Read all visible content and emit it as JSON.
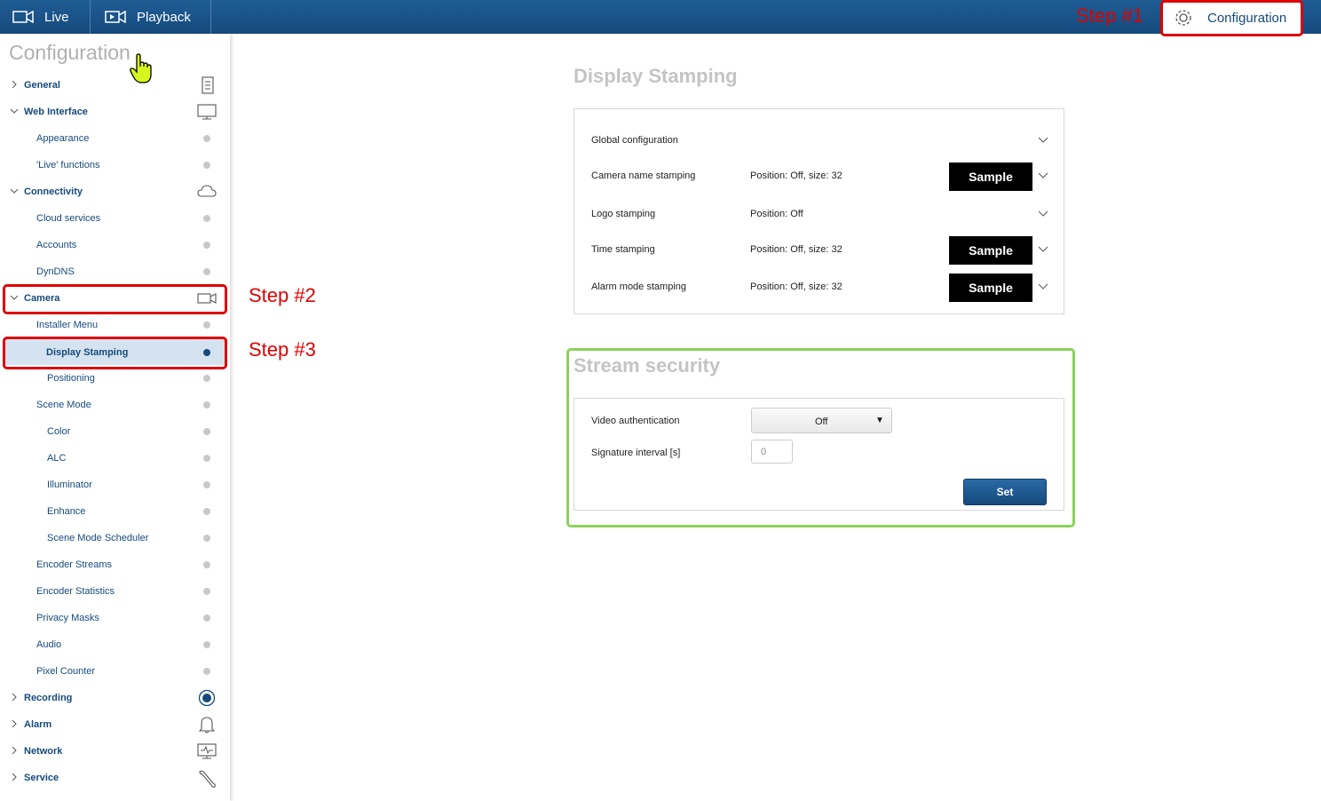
{
  "topbar": {
    "live_label": "Live",
    "playback_label": "Playback",
    "config_label": "Configuration"
  },
  "annotations": {
    "step1": "Step #1",
    "step2": "Step #2",
    "step3": "Step #3"
  },
  "sidebar": {
    "title": "Configuration",
    "items": [
      {
        "label": "General"
      },
      {
        "label": "Web Interface"
      },
      {
        "label": "Appearance"
      },
      {
        "label": "'Live' functions"
      },
      {
        "label": "Connectivity"
      },
      {
        "label": "Cloud services"
      },
      {
        "label": "Accounts"
      },
      {
        "label": "DynDNS"
      },
      {
        "label": "Camera"
      },
      {
        "label": "Installer Menu"
      },
      {
        "label": "Display Stamping"
      },
      {
        "label": "Positioning"
      },
      {
        "label": "Scene Mode"
      },
      {
        "label": "Color"
      },
      {
        "label": "ALC"
      },
      {
        "label": "Illuminator"
      },
      {
        "label": "Enhance"
      },
      {
        "label": "Scene Mode Scheduler"
      },
      {
        "label": "Encoder Streams"
      },
      {
        "label": "Encoder Statistics"
      },
      {
        "label": "Privacy Masks"
      },
      {
        "label": "Audio"
      },
      {
        "label": "Pixel Counter"
      },
      {
        "label": "Recording"
      },
      {
        "label": "Alarm"
      },
      {
        "label": "Network"
      },
      {
        "label": "Service"
      }
    ]
  },
  "display_stamping": {
    "title": "Display Stamping",
    "rows": [
      {
        "label": "Global configuration",
        "value": "",
        "sample": ""
      },
      {
        "label": "Camera name stamping",
        "value": "Position: Off, size: 32",
        "sample": "Sample"
      },
      {
        "label": "Logo stamping",
        "value": "Position: Off",
        "sample": ""
      },
      {
        "label": "Time stamping",
        "value": "Position: Off, size: 32",
        "sample": "Sample"
      },
      {
        "label": "Alarm mode stamping",
        "value": "Position: Off, size: 32",
        "sample": "Sample"
      }
    ]
  },
  "stream_security": {
    "title": "Stream security",
    "video_auth_label": "Video authentication",
    "video_auth_value": "Off",
    "signature_label": "Signature interval [s]",
    "signature_value": "0",
    "set_label": "Set"
  }
}
